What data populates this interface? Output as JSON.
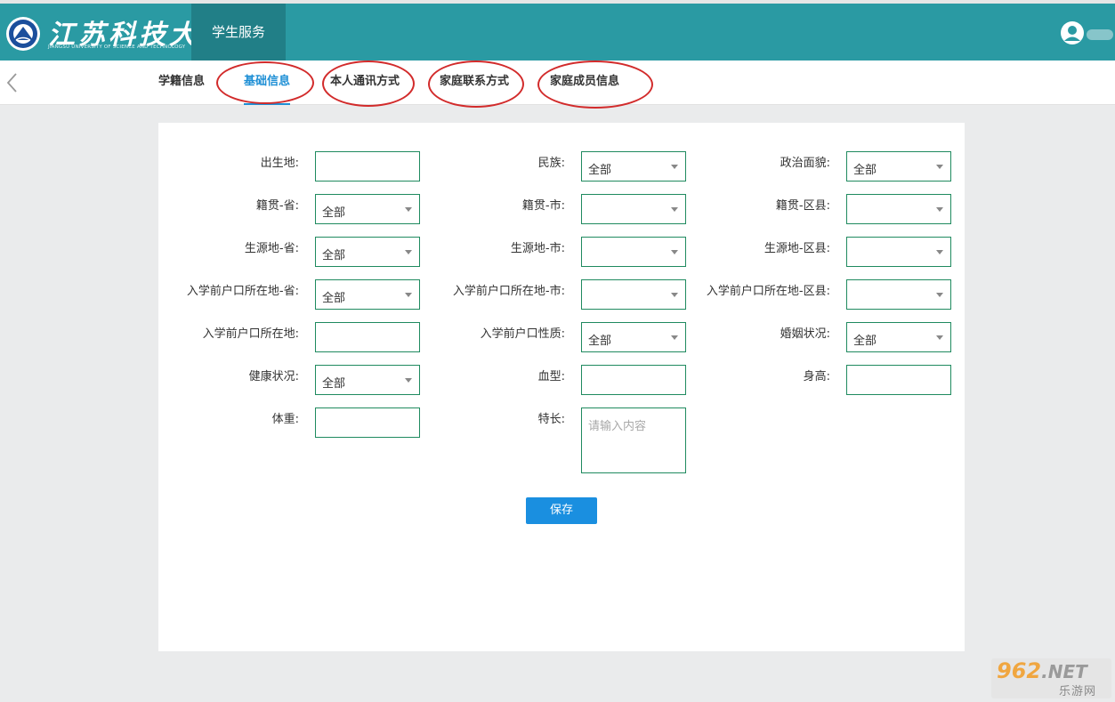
{
  "header": {
    "logo_cn": "江苏科技大学",
    "logo_en": "JIANGSU UNIVERSITY OF SCIENCE AND TECHNOLOGY",
    "nav_item": "学生服务"
  },
  "tabs": [
    {
      "label": "学籍信息",
      "active": false
    },
    {
      "label": "基础信息",
      "active": true
    },
    {
      "label": "本人通讯方式",
      "active": false
    },
    {
      "label": "家庭联系方式",
      "active": false
    },
    {
      "label": "家庭成员信息",
      "active": false
    }
  ],
  "form": {
    "fields": [
      {
        "label": "出生地:",
        "type": "text",
        "value": ""
      },
      {
        "label": "民族:",
        "type": "select",
        "value": "全部"
      },
      {
        "label": "政治面貌:",
        "type": "select",
        "value": "全部"
      },
      {
        "label": "籍贯-省:",
        "type": "select",
        "value": "全部"
      },
      {
        "label": "籍贯-市:",
        "type": "select",
        "value": ""
      },
      {
        "label": "籍贯-区县:",
        "type": "select",
        "value": ""
      },
      {
        "label": "生源地-省:",
        "type": "select",
        "value": "全部"
      },
      {
        "label": "生源地-市:",
        "type": "select",
        "value": ""
      },
      {
        "label": "生源地-区县:",
        "type": "select",
        "value": ""
      },
      {
        "label": "入学前户口所在地-省:",
        "type": "select",
        "value": "全部"
      },
      {
        "label": "入学前户口所在地-市:",
        "type": "select",
        "value": ""
      },
      {
        "label": "入学前户口所在地-区县:",
        "type": "select",
        "value": ""
      },
      {
        "label": "入学前户口所在地:",
        "type": "text",
        "value": ""
      },
      {
        "label": "入学前户口性质:",
        "type": "select",
        "value": "全部"
      },
      {
        "label": "婚姻状况:",
        "type": "select",
        "value": "全部"
      },
      {
        "label": "健康状况:",
        "type": "select",
        "value": "全部"
      },
      {
        "label": "血型:",
        "type": "text",
        "value": ""
      },
      {
        "label": "身高:",
        "type": "text",
        "value": ""
      },
      {
        "label": "体重:",
        "type": "text",
        "value": ""
      },
      {
        "label": "特长:",
        "type": "textarea",
        "placeholder": "请输入内容"
      }
    ],
    "save_label": "保存"
  },
  "watermark": {
    "top": "962",
    "net": ".NET",
    "bottom": "乐游网"
  },
  "colors": {
    "header": "#2a9aa3",
    "nav_active": "#217f87",
    "accent": "#1e8fd5",
    "border": "#1f8a5f",
    "highlight": "#d22b2b"
  }
}
